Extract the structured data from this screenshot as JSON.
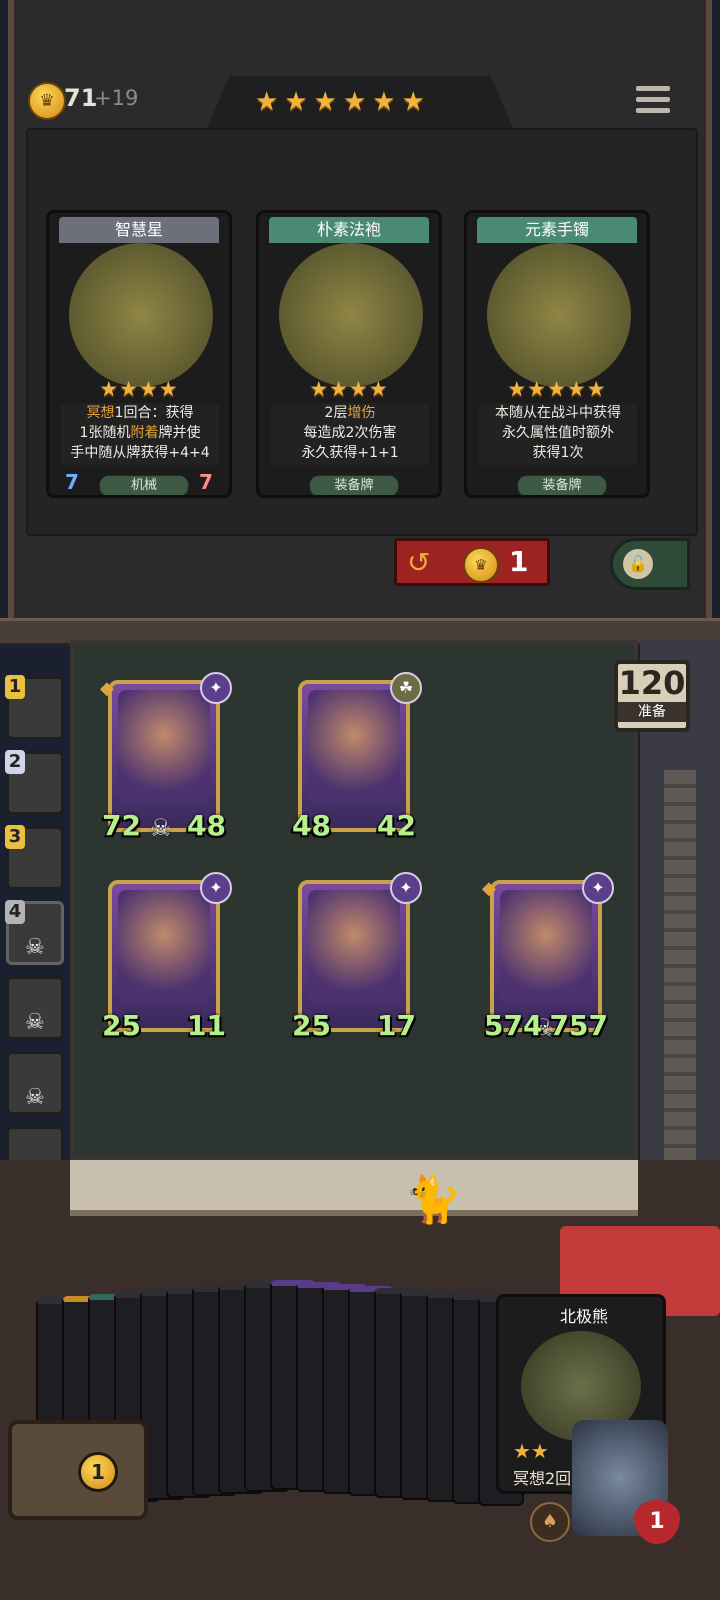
{
  "header": {
    "gold": "71",
    "gold_income": "+19",
    "tier_stars": 6,
    "star_glyph": "★"
  },
  "shop_cards": [
    {
      "name": "智慧星",
      "stars": "★★★★",
      "desc_html": "<span class='hl'>冥想</span>1回合：获得<br>1张随机<span class='hl'>附着</span>牌并使<br>手中随从牌获得+4+4",
      "tag": "机械",
      "attack": "7",
      "health": "7",
      "header_color": "#6d6f7a",
      "icon": "robot-icon"
    },
    {
      "name": "朴素法袍",
      "stars": "★★★★",
      "desc_html": "2层<span class='hl'>增伤</span><br>每造成2次伤害<br>永久获得+1+1",
      "tag": "装备牌",
      "header_color": "#4a8a72",
      "icon": "robe-icon"
    },
    {
      "name": "元素手镯",
      "stars": "★★★★★",
      "desc_html": "本随从在战斗中获得<br>永久属性值时额外<br>获得1次",
      "tag": "装备牌",
      "header_color": "#4a8a72",
      "icon": "bracelet-icon"
    }
  ],
  "refresh": {
    "cost": "1",
    "icon": "refresh-icon"
  },
  "lock": {
    "icon": "lock-icon"
  },
  "timer": {
    "value": "120",
    "label": "准备"
  },
  "board": [
    {
      "attack": "72",
      "health": "48",
      "skull": true,
      "tribe": "✦",
      "diamond": true
    },
    {
      "attack": "48",
      "health": "42",
      "skull": false,
      "tribe": "☘",
      "tribe_green": true
    },
    {
      "attack": "25",
      "health": "11",
      "skull": false,
      "tribe": "✦"
    },
    {
      "attack": "25",
      "health": "17",
      "skull": false,
      "tribe": "✦"
    },
    {
      "attack": "574",
      "health": "757",
      "skull": true,
      "tribe": "✦",
      "diamond": true
    }
  ],
  "players": [
    {
      "rank": "1",
      "dead": false
    },
    {
      "rank": "2",
      "dead": false
    },
    {
      "rank": "3",
      "dead": false
    },
    {
      "rank": "4",
      "dead": true
    },
    {
      "rank": "",
      "dead": true
    },
    {
      "rank": "",
      "dead": true
    },
    {
      "rank": "",
      "dead": true
    },
    {
      "rank": "",
      "dead": true
    }
  ],
  "hand": {
    "count": 18,
    "top_card": {
      "name": "北极熊",
      "stars": "★★",
      "text": "冥想2回"
    }
  },
  "chest": {
    "value": "1"
  },
  "life": {
    "value": "1"
  }
}
